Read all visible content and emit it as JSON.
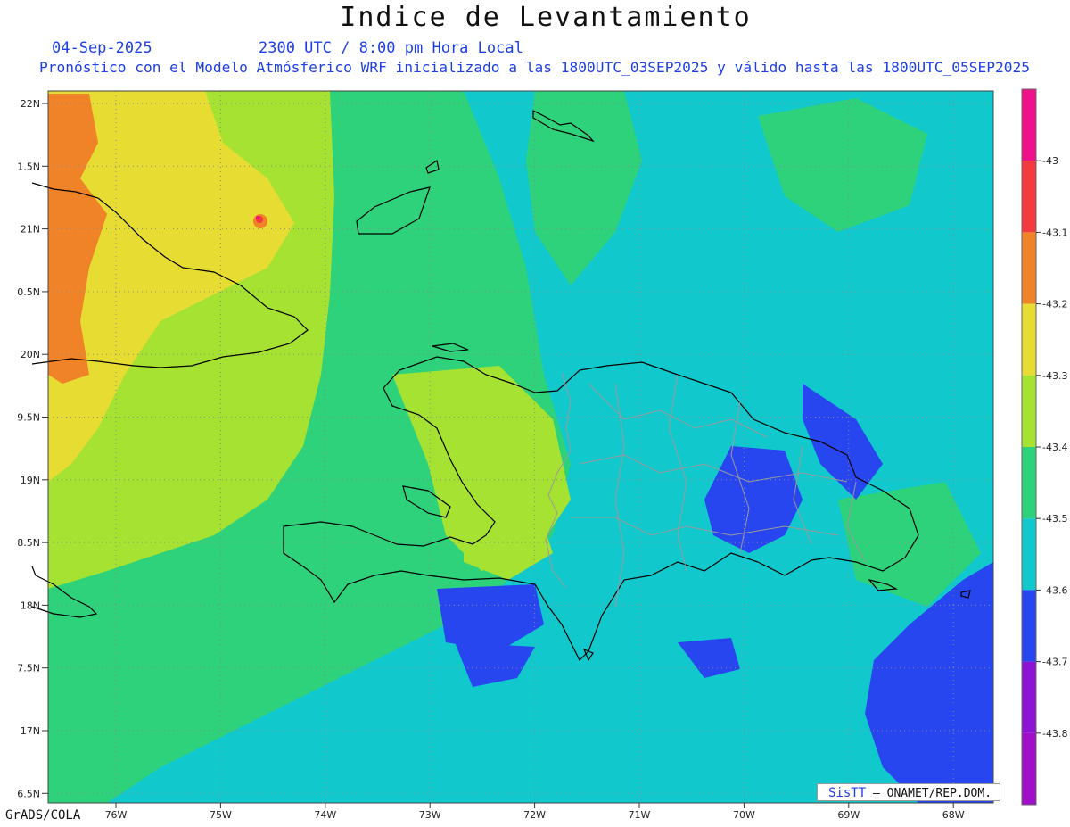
{
  "title": "Indice de Levantamiento",
  "date": "04-Sep-2025",
  "time": "2300 UTC / 8:00 pm Hora Local",
  "info": "Pronóstico con el Modelo Atmósferico WRF inicializado a las 1800UTC_03SEP2025 y válido hasta las  1800UTC_05SEP2025",
  "footer": "GrADS/COLA",
  "credit": {
    "logo": "SisTT",
    "org": "– ONAMET/REP.DOM."
  },
  "axes": {
    "lat_labels": [
      "22N",
      "1.5N",
      "21N",
      "0.5N",
      "20N",
      "9.5N",
      "19N",
      "8.5N",
      "18N",
      "7.5N",
      "17N",
      "6.5N"
    ],
    "lon_labels": [
      "76W",
      "75W",
      "74W",
      "73W",
      "72W",
      "71W",
      "70W",
      "69W",
      "68W"
    ]
  },
  "colorbar": {
    "labels": [
      "-43",
      "-43.1",
      "-43.2",
      "-43.3",
      "-43.4",
      "-43.5",
      "-43.6",
      "-43.7",
      "-43.8"
    ],
    "colors": [
      "#f0108a",
      "#f43a3e",
      "#f08228",
      "#e6dc32",
      "#a6e232",
      "#2ed27a",
      "#11c8cc",
      "#2846f0",
      "#8c14d2",
      "#a010c8"
    ]
  }
}
